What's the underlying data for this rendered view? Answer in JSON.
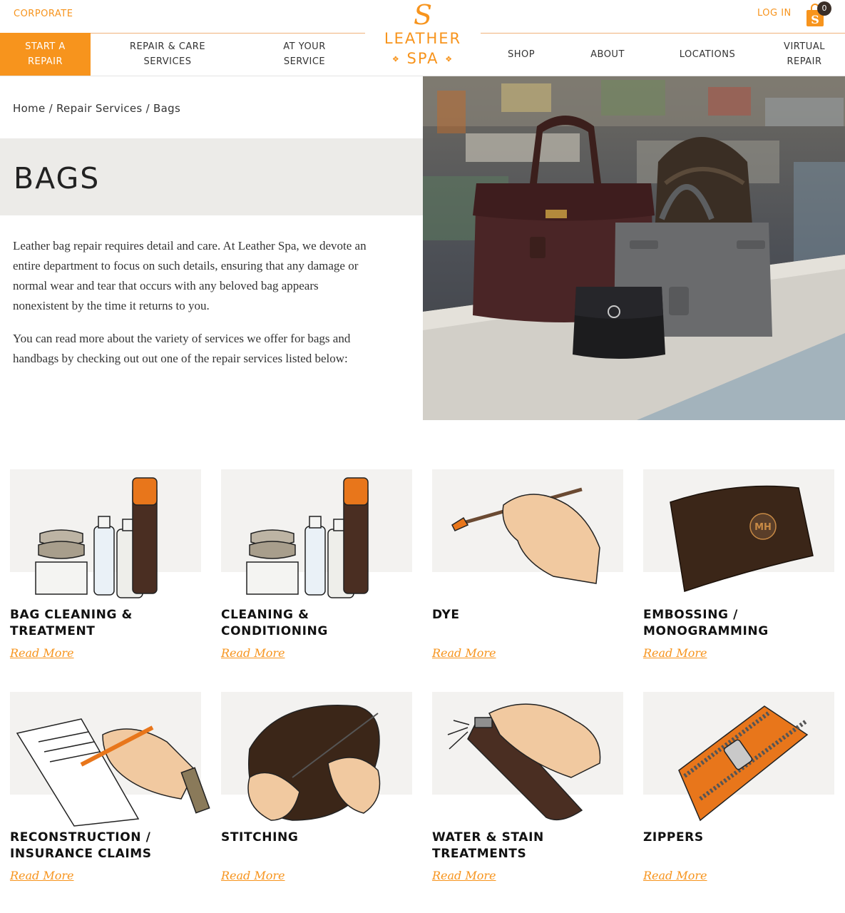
{
  "header": {
    "corporate_label": "CORPORATE",
    "login_label": "LOG IN",
    "cart_count": "0",
    "logo_line1": "LEATHER",
    "logo_line2": "SPA",
    "logo_mark": "S",
    "brand_color": "#f7941d"
  },
  "nav": {
    "start_repair": "START A\nREPAIR",
    "repair_care": "REPAIR & CARE\nSERVICES",
    "at_your_service": "AT YOUR\nSERVICE",
    "shop": "SHOP",
    "about": "ABOUT",
    "locations": "LOCATIONS",
    "virtual_repair": "VIRTUAL\nREPAIR"
  },
  "breadcrumb": {
    "home": "Home",
    "sep1": " / ",
    "repair_services": "Repair Services",
    "sep2": " / ",
    "current": "Bags"
  },
  "page": {
    "title": "BAGS",
    "intro_p1": "Leather bag repair requires detail and care. At Leather Spa, we devote an entire department to focus on such details, ensuring that any damage or normal wear and tear that occurs with any beloved bag appears nonexistent by the time it returns to you.",
    "intro_p2": "You can read more about the variety of services we offer for bags and handbags by checking out out one of the repair services listed below:"
  },
  "services": [
    {
      "title": "BAG CLEANING &\nTREATMENT",
      "link": "Read More",
      "icon": "cleaning-products-icon"
    },
    {
      "title": "CLEANING &\nCONDITIONING",
      "link": "Read More",
      "icon": "cleaning-products-icon"
    },
    {
      "title": "DYE",
      "link": "Read More",
      "icon": "paintbrush-hand-icon"
    },
    {
      "title": "EMBOSSING /\nMONOGRAMMING",
      "link": "Read More",
      "icon": "monogram-wallet-icon"
    },
    {
      "title": "RECONSTRUCTION /\nINSURANCE CLAIMS",
      "link": "Read More",
      "icon": "pen-writing-icon"
    },
    {
      "title": "STITCHING",
      "link": "Read More",
      "icon": "needle-stitching-icon"
    },
    {
      "title": "WATER & STAIN\nTREATMENTS",
      "link": "Read More",
      "icon": "spray-can-icon"
    },
    {
      "title": "ZIPPERS",
      "link": "Read More",
      "icon": "zipper-icon"
    }
  ]
}
